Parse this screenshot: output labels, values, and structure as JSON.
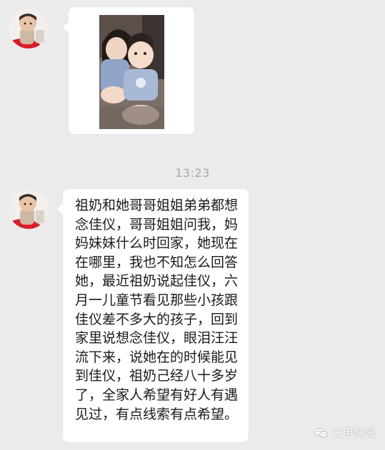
{
  "chat": {
    "timestamp": "13:23",
    "message": "祖奶和她哥哥姐姐弟弟都想念佳仪，哥哥姐姐问我，妈妈妹妹什么时回家，她现在在哪里，我也不知怎么回答她，最近祖奶说起佳仪，六月一儿童节看见那些小孩跟佳仪差不多大的孩子，回到家里说想念佳仪，眼泪汪汪流下来，说她在的时候能见到佳仪，祖奶己经八十多岁了，全家人希望有好人有遇见过，有点线索有点希望。"
  },
  "watermark": {
    "label": "三甲快讯",
    "icon": "wechat-icon"
  },
  "colors": {
    "background": "#ebebeb",
    "bubble": "#ffffff",
    "timestamp": "#a6a6a6",
    "text": "#1a1a1a"
  }
}
